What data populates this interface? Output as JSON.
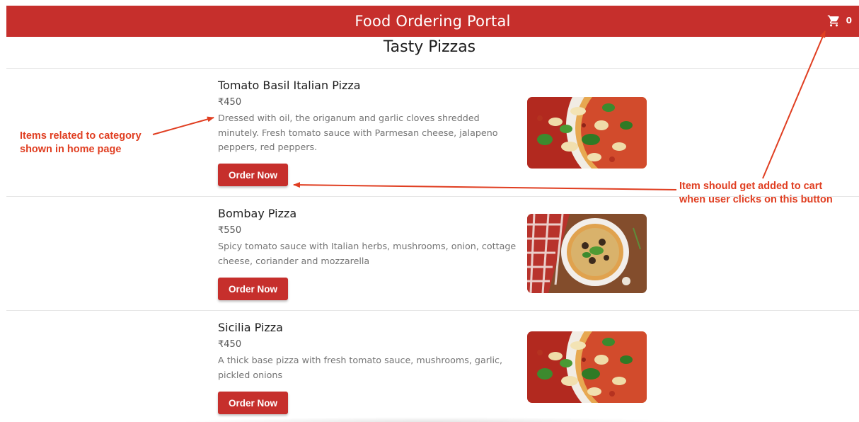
{
  "header": {
    "title": "Food Ordering Portal",
    "cart_icon": "cart-icon",
    "cart_count": "0"
  },
  "category": {
    "title": "Tasty Pizzas"
  },
  "items": [
    {
      "name": "Tomato Basil Italian Pizza",
      "price": "₹450",
      "description": "Dressed with oil, the origanum and garlic cloves shredded minutely. Fresh tomato sauce with Parmesan cheese, jalapeno peppers, red peppers.",
      "button": "Order Now"
    },
    {
      "name": "Bombay Pizza",
      "price": "₹550",
      "description": "Spicy tomato sauce with Italian herbs, mushrooms, onion, cottage cheese, coriander and mozzarella",
      "button": "Order Now"
    },
    {
      "name": "Sicilia Pizza",
      "price": "₹450",
      "description": "A thick base pizza with fresh tomato sauce, mushrooms, garlic, pickled onions",
      "button": "Order Now"
    }
  ],
  "annotations": {
    "left_line1": "Items related to category",
    "left_line2": "shown in home page",
    "right_line1": "Item should get added to cart",
    "right_line2": "when user clicks on this button"
  },
  "colors": {
    "brand": "#c62f2c",
    "annotation": "#e03e21",
    "background": "#ffffff"
  }
}
